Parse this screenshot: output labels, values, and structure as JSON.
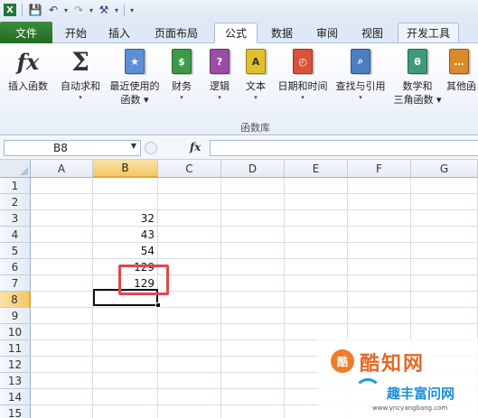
{
  "quick_access": {
    "save_icon": "save-icon",
    "undo_icon": "undo-icon",
    "redo_icon": "redo-icon",
    "customize_icon": "customize-icon"
  },
  "tabs": [
    {
      "label": "文件",
      "active": false
    },
    {
      "label": "开始",
      "active": false
    },
    {
      "label": "插入",
      "active": false
    },
    {
      "label": "页面布局",
      "active": false
    },
    {
      "label": "公式",
      "active": true
    },
    {
      "label": "数据",
      "active": false
    },
    {
      "label": "审阅",
      "active": false
    },
    {
      "label": "视图",
      "active": false
    },
    {
      "label": "开发工具",
      "active": false
    }
  ],
  "ribbon": {
    "buttons": [
      {
        "label1": "插入函数",
        "label2": "",
        "icon": "fx-icon"
      },
      {
        "label1": "自动求和",
        "label2": "▾",
        "icon": "sigma-icon"
      },
      {
        "label1": "最近使用的",
        "label2": "函数 ▾",
        "icon": "star-book-icon",
        "color": "#5b8fd6"
      },
      {
        "label1": "财务",
        "label2": "▾",
        "icon": "finance-book-icon",
        "color": "#3f9a48"
      },
      {
        "label1": "逻辑",
        "label2": "▾",
        "icon": "logic-book-icon",
        "color": "#9a4ea3",
        "glyph": "?"
      },
      {
        "label1": "文本",
        "label2": "▾",
        "icon": "text-book-icon",
        "color": "#e0c12a",
        "glyph": "A"
      },
      {
        "label1": "日期和时间",
        "label2": "▾",
        "icon": "datetime-book-icon",
        "color": "#d9533a"
      },
      {
        "label1": "查找与引用",
        "label2": "▾",
        "icon": "lookup-book-icon",
        "color": "#4a7fc2"
      },
      {
        "label1": "数学和",
        "label2": "三角函数 ▾",
        "icon": "math-book-icon",
        "color": "#3f9a7a",
        "glyph": "θ"
      },
      {
        "label1": "其他函",
        "label2": "",
        "icon": "more-book-icon",
        "color": "#d98a2a"
      }
    ],
    "group_label": "函数库"
  },
  "formula_bar": {
    "name_box": "B8",
    "fx_label": "fx",
    "formula": ""
  },
  "grid": {
    "columns": [
      "A",
      "B",
      "C",
      "D",
      "E",
      "F",
      "G"
    ],
    "rows": [
      "1",
      "2",
      "3",
      "4",
      "5",
      "6",
      "7",
      "8",
      "9",
      "10",
      "11",
      "12",
      "13",
      "14",
      "15"
    ],
    "selected_column": "B",
    "selected_row": "8",
    "cells": [
      {
        "ref": "B3",
        "value": "32"
      },
      {
        "ref": "B4",
        "value": "43"
      },
      {
        "ref": "B5",
        "value": "54"
      },
      {
        "ref": "B6",
        "value": "129"
      },
      {
        "ref": "B7",
        "value": "129"
      }
    ]
  },
  "watermark": {
    "logo": "酷",
    "brand1": "酷知网",
    "brand2": "趣丰富问网",
    "url": "www.yncyangbang.com"
  }
}
